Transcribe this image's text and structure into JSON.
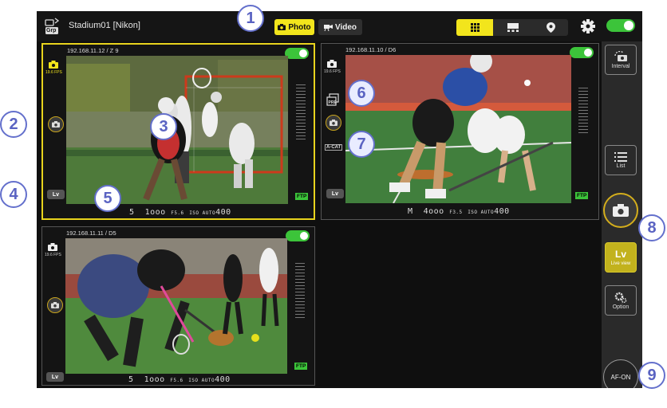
{
  "header": {
    "group_icon_label": "Grp",
    "title": "Stadium01 [Nikon]",
    "photo_label": "Photo",
    "video_label": "Video"
  },
  "panels": [
    {
      "label": "192.168.11.12 / Z 9",
      "fps": "19.6 FPS",
      "lv": "Lv",
      "ftp": "FTP",
      "exposure": {
        "mode": "5",
        "shutter": "1ooo",
        "aperture": "F5.6",
        "iso_label": "ISO AUTO",
        "iso": "400"
      }
    },
    {
      "label": "192.168.11.10 / D6",
      "fps": "19.6 FPS",
      "lv": "Lv",
      "ftp": "FTP",
      "af_label": "A-CAT",
      "exposure": {
        "mode": "M",
        "shutter": "4ooo",
        "aperture": "F3.5",
        "iso_label": "ISO AUTO",
        "iso": "400"
      }
    },
    {
      "label": "192.168.11.11 / D5",
      "fps": "19.6 FPS",
      "lv": "Lv",
      "ftp": "FTP",
      "exposure": {
        "mode": "5",
        "shutter": "1ooo",
        "aperture": "F5.6",
        "iso_label": "ISO AUTO",
        "iso": "400"
      }
    }
  ],
  "sidebar": {
    "interval_label": "Interval",
    "list_label": "List",
    "lv_label": "Lv",
    "live_view_label": "Live view",
    "option_label": "Option",
    "afon_label": "AF-ON"
  },
  "callouts": [
    "1",
    "2",
    "3",
    "4",
    "5",
    "6",
    "7",
    "8",
    "9"
  ],
  "colors": {
    "accent": "#f2e51c",
    "toggle": "#3cc43a",
    "callout": "#6470cc"
  }
}
